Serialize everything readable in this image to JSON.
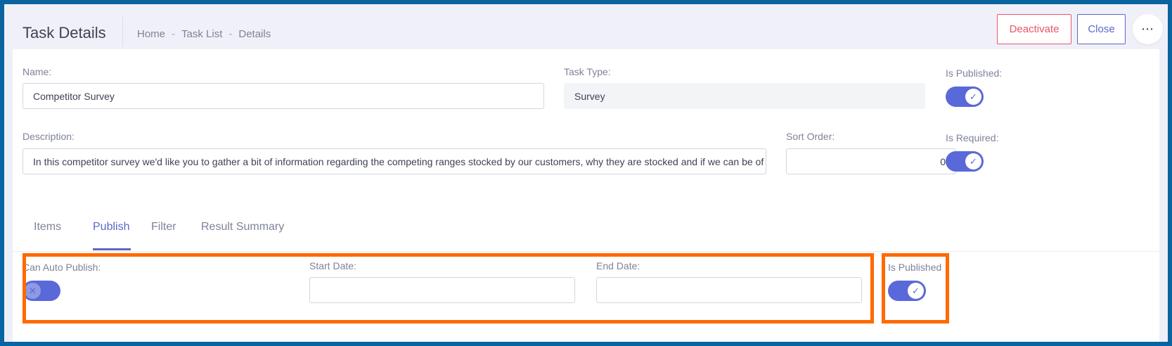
{
  "header": {
    "title": "Task Details",
    "breadcrumb": [
      "Home",
      "Task List",
      "Details"
    ],
    "breadcrumb_separator": "-",
    "deactivate_label": "Deactivate",
    "close_label": "Close",
    "more_icon": "⋯"
  },
  "form": {
    "name_label": "Name:",
    "name_value": "Competitor Survey",
    "task_type_label": "Task Type:",
    "task_type_value": "Survey",
    "is_published_label": "Is Published:",
    "is_published": true,
    "description_label": "Description:",
    "description_value": "In this competitor survey we'd like you to gather a bit of information regarding the competing ranges stocked by our customers, why they are stocked and if we can be of",
    "sort_order_label": "Sort Order:",
    "sort_order_value": "0",
    "is_required_label": "Is Required:",
    "is_required": true
  },
  "tabs": [
    {
      "label": "Items",
      "active": false
    },
    {
      "label": "Publish",
      "active": true
    },
    {
      "label": "Filter",
      "active": false
    },
    {
      "label": "Result Summary",
      "active": false
    }
  ],
  "publish": {
    "can_auto_publish_label": "Can Auto Publish:",
    "can_auto_publish": false,
    "start_date_label": "Start Date:",
    "start_date_value": "",
    "end_date_label": "End Date:",
    "end_date_value": "",
    "is_published_label": "Is Published",
    "is_published": true
  },
  "colors": {
    "accent": "#5a69d9",
    "danger": "#e9546b",
    "highlight": "#ff6a00",
    "frame": "#0a64a0"
  },
  "icons": {
    "check": "✓",
    "cross": "✕"
  }
}
